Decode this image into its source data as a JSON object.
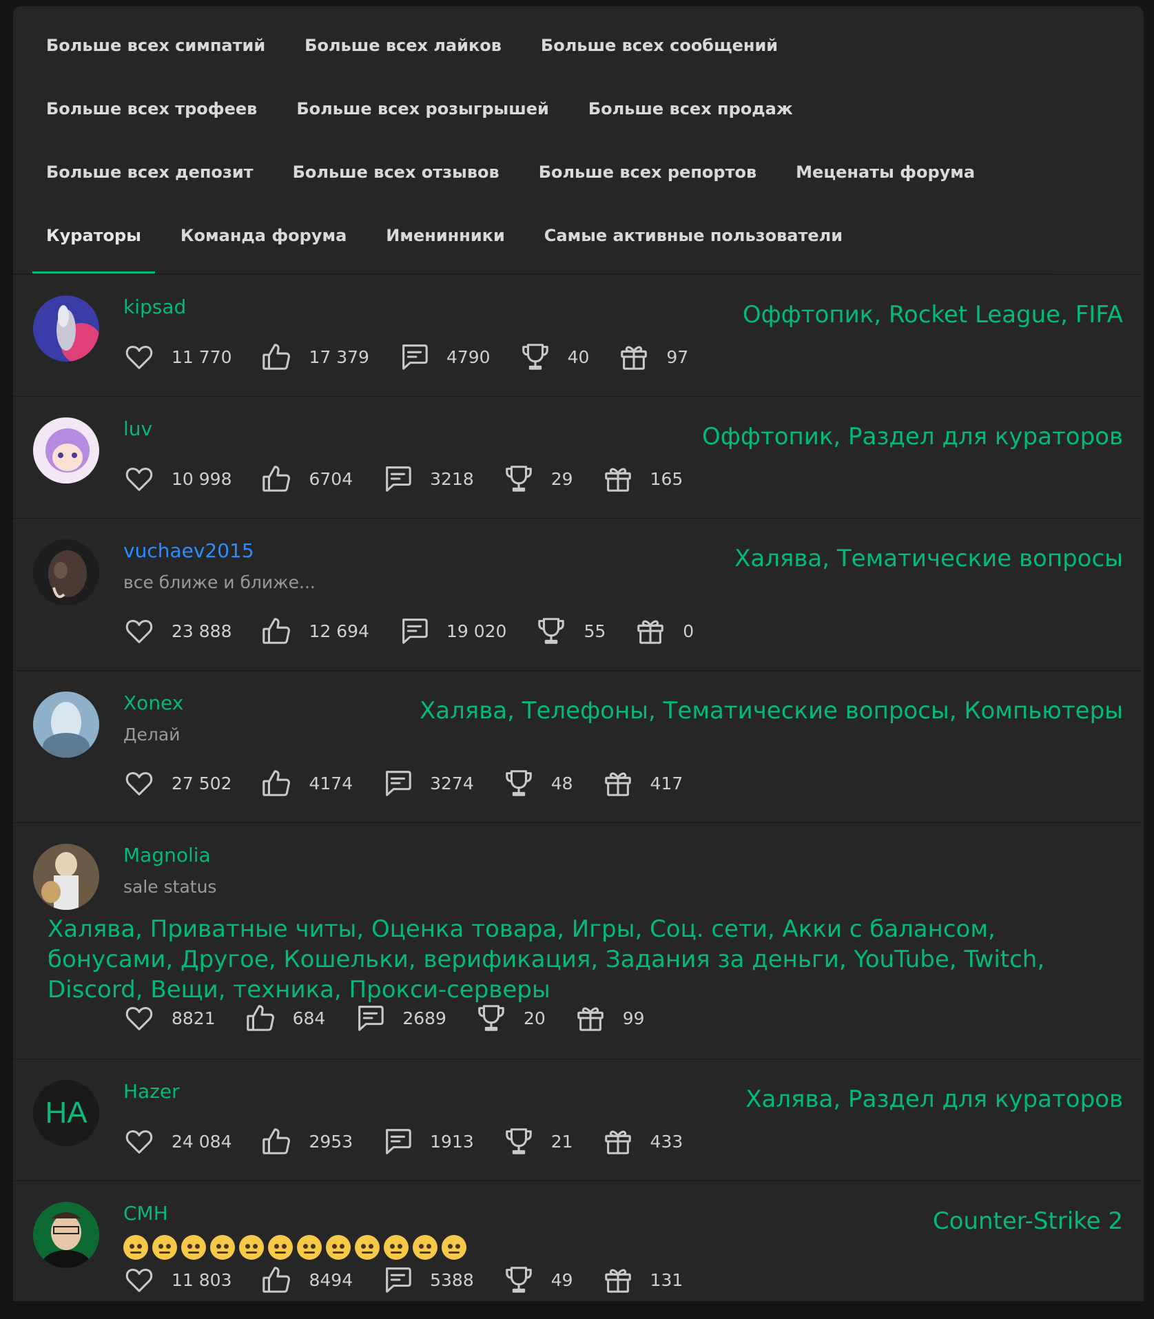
{
  "tabs": [
    {
      "label": "Больше всех симпатий",
      "active": false
    },
    {
      "label": "Больше всех лайков",
      "active": false
    },
    {
      "label": "Больше всех сообщений",
      "active": false
    },
    {
      "label": "Больше всех трофеев",
      "active": false
    },
    {
      "label": "Больше всех розыгрышей",
      "active": false
    },
    {
      "label": "Больше всех продаж",
      "active": false
    },
    {
      "label": "Больше всех депозит",
      "active": false
    },
    {
      "label": "Больше всех отзывов",
      "active": false
    },
    {
      "label": "Больше всех репортов",
      "active": false
    },
    {
      "label": "Меценаты форума",
      "active": false
    },
    {
      "label": "Кураторы",
      "active": true
    },
    {
      "label": "Команда форума",
      "active": false
    },
    {
      "label": "Именинники",
      "active": false
    },
    {
      "label": "Самые активные пользователи",
      "active": false
    }
  ],
  "colors": {
    "accent": "#00ba78",
    "link_blue": "#2d8cff",
    "background": "#262626"
  },
  "icons": [
    "heart-icon",
    "thumbs-up-icon",
    "message-icon",
    "trophy-icon",
    "gift-icon"
  ],
  "users": [
    {
      "name": "kipsad",
      "status": "",
      "sections": "Оффтопик, Rocket League, FIFA",
      "stats": [
        "11 770",
        "17 379",
        "4790",
        "40",
        "97"
      ]
    },
    {
      "name": "luv",
      "status": "",
      "sections": "Оффтопик, Раздел для кураторов",
      "stats": [
        "10 998",
        "6704",
        "3218",
        "29",
        "165"
      ]
    },
    {
      "name": "vuchaev2015",
      "status": "все ближе и ближе...",
      "sections": "Халява, Тематические вопросы",
      "stats": [
        "23 888",
        "12 694",
        "19 020",
        "55",
        "0"
      ]
    },
    {
      "name": "Xonex",
      "status": "Делай",
      "sections": "Халява, Телефоны, Тематические вопросы, Компьютеры",
      "stats": [
        "27 502",
        "4174",
        "3274",
        "48",
        "417"
      ]
    },
    {
      "name": "Magnolia",
      "status": "sale status",
      "sections": "Халява, Приватные читы, Оценка товара, Игры, Соц. сети, Акки с балансом, бонусами, Другое, Кошельки, верификация, Задания за деньги, YouTube, Twitch, Discord, Вещи, техника, Прокси-серверы",
      "stats": [
        "8821",
        "684",
        "2689",
        "20",
        "99"
      ]
    },
    {
      "name": "Hazer",
      "status": "",
      "avatar_initials": "HA",
      "sections": "Халява, Раздел для кураторов",
      "stats": [
        "24 084",
        "2953",
        "1913",
        "21",
        "433"
      ]
    },
    {
      "name": "СМН",
      "status": "",
      "sections": "Counter-Strike 2",
      "stats": [
        "11 803",
        "8494",
        "5388",
        "49",
        "131"
      ]
    }
  ]
}
